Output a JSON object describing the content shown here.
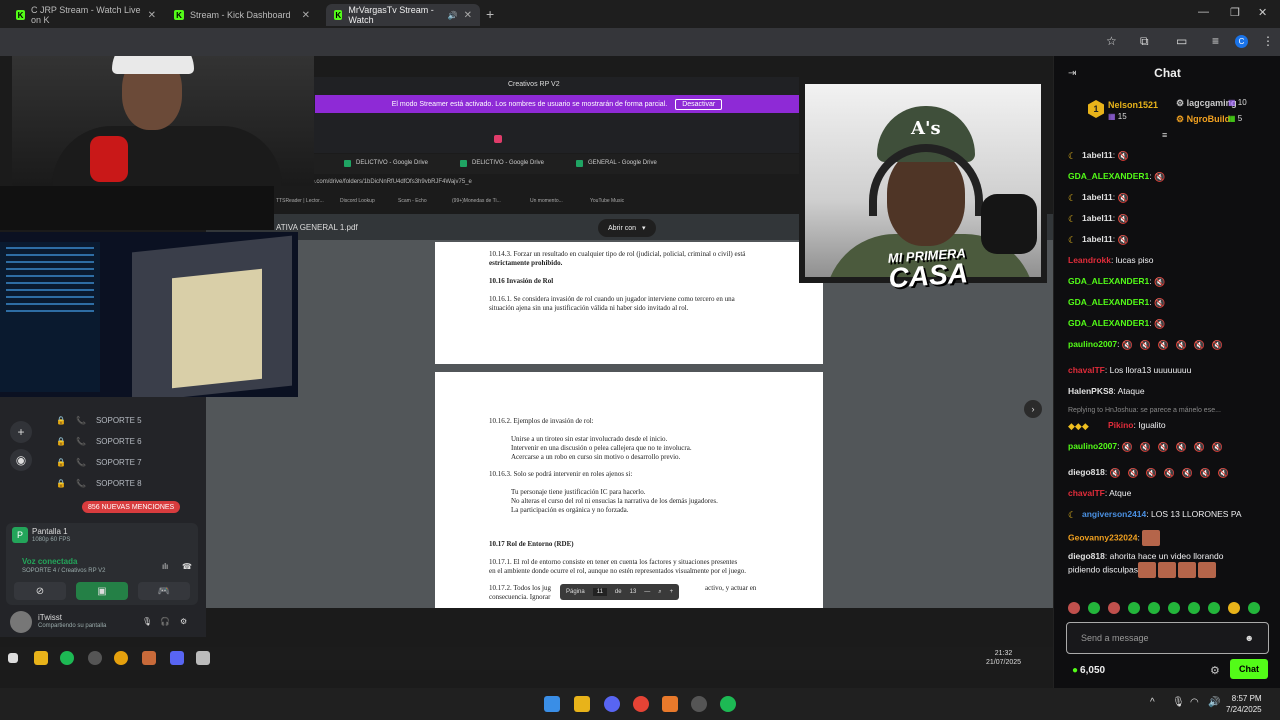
{
  "browser": {
    "tabs": [
      {
        "title": "C JRP Stream - Watch Live on K",
        "icon": "kick-icon"
      },
      {
        "title": "Stream - Kick Dashboard",
        "icon": "kick-icon"
      },
      {
        "title": "MrVargasTv Stream - Watch",
        "icon": "kick-icon"
      }
    ],
    "profile_initial": "C"
  },
  "stream": {
    "discord": {
      "channels": [
        "SOPORTE 5",
        "SOPORTE 6",
        "SOPORTE 7",
        "SOPORTE 8"
      ],
      "mentions_badge": "856 NUEVAS MENCIONES",
      "screen_label": "Pantalla 1",
      "screen_sub": "1080p 60 FPS",
      "voice_status": "Voz conectada",
      "voice_channel": "SOPORTE 4 / Creativos RP V2",
      "user_name": "iTwisst",
      "user_status": "Compartiendo su pantalla"
    },
    "inner_browser": {
      "site_title": "Creativos RP V2",
      "streamer_notice": "El modo Streamer está activado. Los nombres de usuario se mostrarán de forma parcial.",
      "deactivate_label": "Desactivar",
      "tabs": [
        "DELICTIVO - Google Drive",
        "DELICTIVO - Google Drive",
        "GENERAL - Google Drive"
      ],
      "url": "drive.google.com/drive/folders/1bDicNnRfU4dfOfs3h9vbRJF4Wajv75_e",
      "bookmarks": [
        "TTSReader | Lector...",
        "Discord Lookup",
        "Scam - Echo",
        "(99+)Monedas de Ti...",
        "Un momento...",
        "YouTube Music"
      ],
      "pdf_name": "ATIVA GENERAL 1.pdf",
      "open_with": "Abrir con"
    },
    "pdf": {
      "page1": [
        "10.14.3. Forzar un resultado en cualquier tipo de rol (judicial, policial, criminal o civil) está",
        "estrictamente prohibido.",
        "10.16 Invasión de Rol",
        "10.16.1. Se considera invasión de rol cuando un jugador interviene como tercero en una",
        "situación ajena sin una justificación válida ni haber sido invitado al rol."
      ],
      "page2": [
        "10.16.2. Ejemplos de invasión de rol:",
        "Unirse a un tiroteo sin estar involucrado desde el inicio.",
        "Intervenir en una discusión o pelea callejera que no te involucra.",
        "Acercarse a un robo en curso sin motivo o desarrollo previo.",
        "10.16.3. Solo se podrá intervenir en roles ajenos si:",
        "Tu personaje tiene justificación IC para hacerlo.",
        "No alteras el curso del rol ni ensucias la narrativa de los demás jugadores.",
        "La participación es orgánica y no forzada.",
        "10.17 Rol de Entorno (RDE)",
        "10.17.1. El rol de entorno consiste en tener en cuenta los factores y situaciones presentes",
        "en el ambiente donde ocurre el rol, aunque no estén representados visualmente por el juego.",
        "10.17.2. Todos los jug",
        "consecuencia. Ignorar",
        "activo, y actuar en"
      ],
      "pager": {
        "label": "Página",
        "current": "11",
        "of": "de",
        "total": "13"
      }
    },
    "overlay_text": {
      "line1": "MI PRIMERA",
      "line2": "CASA"
    },
    "game_clock": {
      "time": "21:32",
      "date": "21/07/2025"
    }
  },
  "chat": {
    "title": "Chat",
    "leaderboard": [
      {
        "rank": "1",
        "name": "Nelson1521",
        "count": "15",
        "color": "#e8b31a"
      },
      {
        "name": "lagcgaming",
        "count": "10",
        "color": "#c9c9c9"
      },
      {
        "name": "NgroBuild",
        "count": "5",
        "color": "#f0a020"
      }
    ],
    "messages": [
      {
        "user": "1abel11",
        "color": "#e0e0e0",
        "text": "",
        "emotes": 1,
        "badge": "moon"
      },
      {
        "user": "GDA_ALEXANDER1",
        "color": "#53fc18",
        "text": "",
        "emotes": 1
      },
      {
        "user": "1abel11",
        "color": "#e0e0e0",
        "text": "",
        "emotes": 1,
        "badge": "moon"
      },
      {
        "user": "1abel11",
        "color": "#e0e0e0",
        "text": "",
        "emotes": 1,
        "badge": "moon"
      },
      {
        "user": "1abel11",
        "color": "#e0e0e0",
        "text": "",
        "emotes": 1,
        "badge": "moon"
      },
      {
        "user": "Leandrokk",
        "color": "#e02c3a",
        "text": "lucas piso",
        "emotes": 0
      },
      {
        "user": "GDA_ALEXANDER1",
        "color": "#53fc18",
        "text": "",
        "emotes": 1
      },
      {
        "user": "GDA_ALEXANDER1",
        "color": "#53fc18",
        "text": "",
        "emotes": 1
      },
      {
        "user": "GDA_ALEXANDER1",
        "color": "#53fc18",
        "text": "",
        "emotes": 1
      },
      {
        "user": "paulino2007",
        "color": "#53fc18",
        "text": "",
        "emotes": 6,
        "wrap": 2
      },
      {
        "user": "chavalTF",
        "color": "#e02c3a",
        "text": "Los llora13 uuuuuuuu",
        "emotes": 0
      },
      {
        "user": "HalenPKS8",
        "color": "#e0e0e0",
        "text": "Ataque",
        "emotes": 0
      },
      {
        "reply": "Replying to HnJoshua: se parece a mánelo ese..."
      },
      {
        "user": "Pikino",
        "color": "#e02c3a",
        "text": "Igualito",
        "emotes": 0,
        "badges": 3
      },
      {
        "user": "paulino2007",
        "color": "#53fc18",
        "text": "",
        "emotes": 6,
        "wrap": 2
      },
      {
        "user": "diego818",
        "color": "#e0e0e0",
        "text": "",
        "emotes": 7
      },
      {
        "user": "chavalTF",
        "color": "#e02c3a",
        "text": "Atque",
        "emotes": 0
      },
      {
        "user": "angiverson2414",
        "color": "#4a90e2",
        "text": "LOS 13 LLORONES PA",
        "emotes": 0,
        "badge": "moon"
      },
      {
        "user": "Geovanny232024",
        "color": "#f0a020",
        "text": "",
        "emotes": 0,
        "big": 1
      },
      {
        "user": "diego818",
        "color": "#e0e0e0",
        "text": "ahorita hace un video llorando",
        "text2": "pidiendo disculpas",
        "emotes": 0,
        "big": 4
      }
    ],
    "input_placeholder": "Send a message",
    "points": "6,050",
    "chat_button": "Chat"
  },
  "system": {
    "time": "8:57 PM",
    "date": "7/24/2025"
  }
}
